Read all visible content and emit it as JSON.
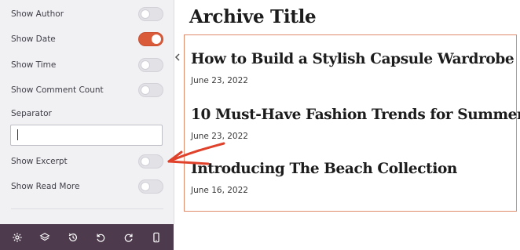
{
  "panel": {
    "toggles": [
      {
        "label": "Show Author",
        "on": false
      },
      {
        "label": "Show Date",
        "on": true
      },
      {
        "label": "Show Time",
        "on": false
      },
      {
        "label": "Show Comment Count",
        "on": false
      },
      {
        "label": "Show Excerpt",
        "on": false
      },
      {
        "label": "Show Read More",
        "on": false
      }
    ],
    "separator_label": "Separator",
    "separator_value": "",
    "collapse_icon": "chevron-left-icon"
  },
  "toolbar": {
    "icons": [
      "gear-icon",
      "layers-icon",
      "history-icon",
      "undo-icon",
      "redo-icon",
      "mobile-preview-icon"
    ]
  },
  "preview": {
    "archive_title": "Archive Title",
    "posts": [
      {
        "title": "How to Build a Stylish Capsule Wardrobe",
        "date": "June 23, 2022"
      },
      {
        "title": "10 Must-Have Fashion Trends for Summer",
        "date": "June 23, 2022"
      },
      {
        "title": "Introducing The Beach Collection",
        "date": "June 16, 2022"
      }
    ]
  },
  "colors": {
    "accent": "#d95b3a",
    "toolbar_bg": "#4e3a4d",
    "arrow": "#e0412a",
    "box_border": "#e08a6c"
  }
}
